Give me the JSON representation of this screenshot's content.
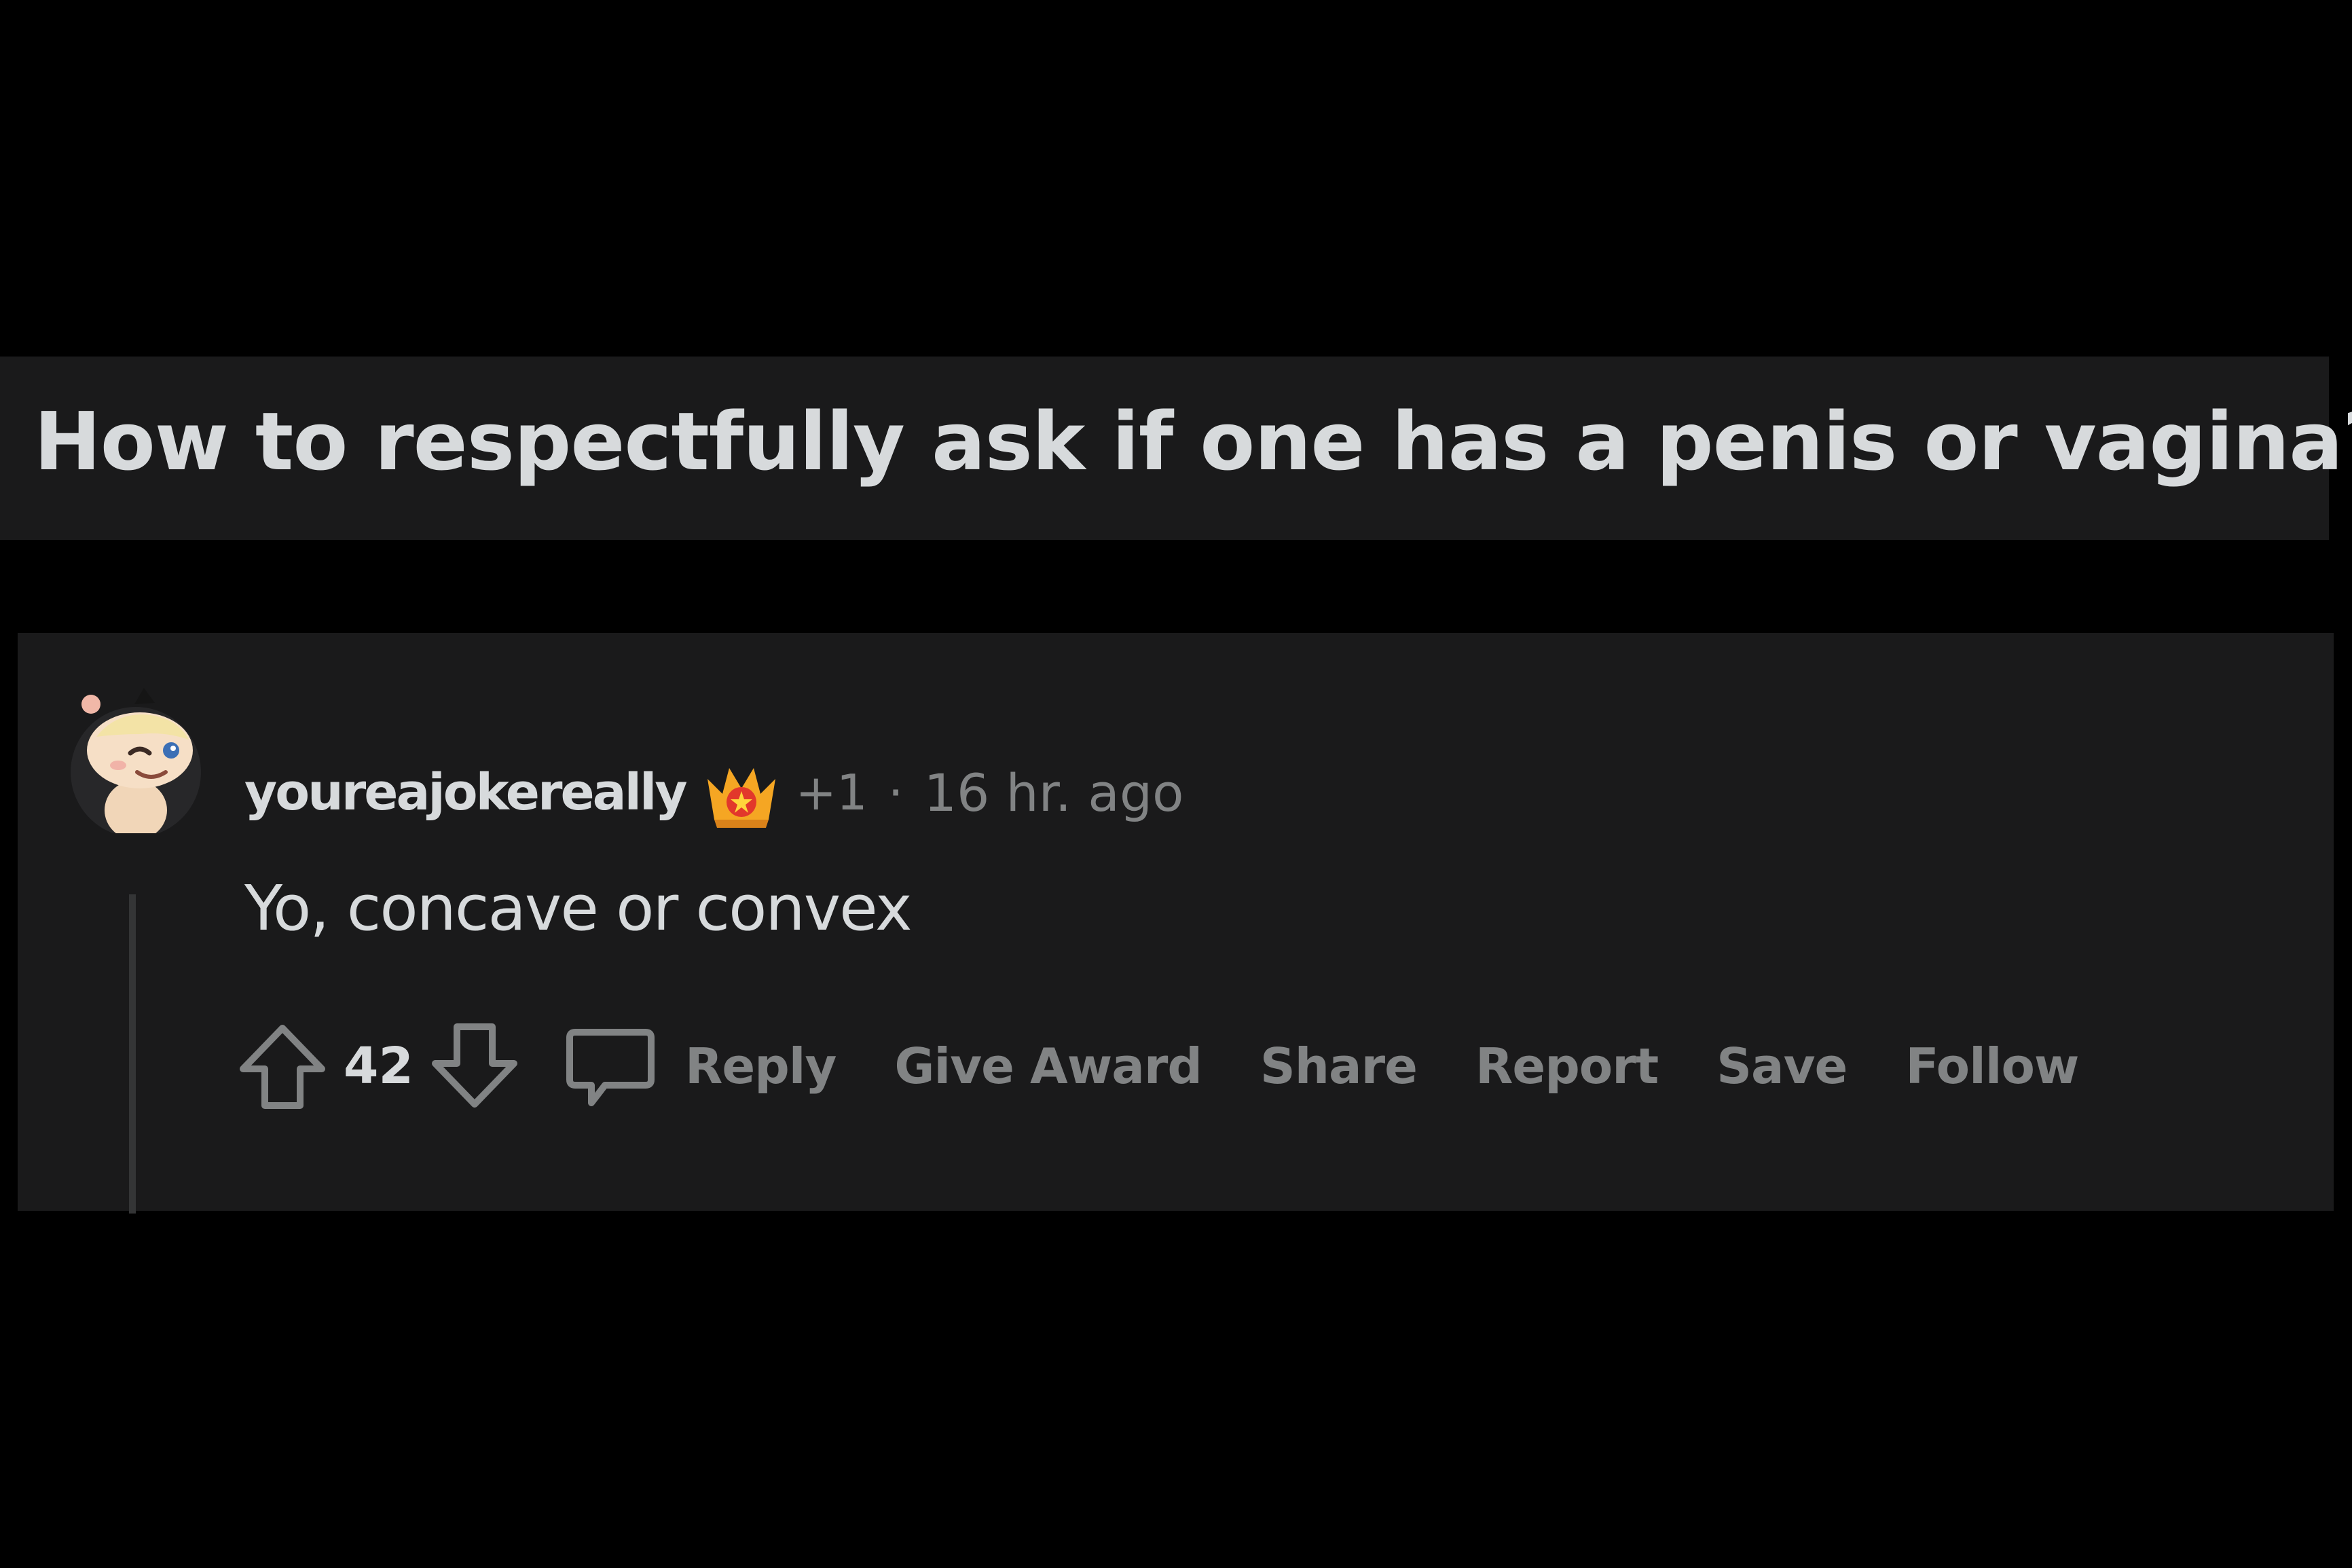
{
  "post": {
    "title": "How to respectfully ask if one has a penis or vagina?"
  },
  "comment": {
    "username": "youreajokereally",
    "award_count": "+1",
    "separator": "·",
    "timestamp": "16 hr. ago",
    "body": "Yo, concave or convex",
    "votes": "42",
    "actions": {
      "reply": "Reply",
      "give_award": "Give Award",
      "share": "Share",
      "report": "Report",
      "save": "Save",
      "follow": "Follow"
    }
  },
  "icons": {
    "avatar": "snoo-avatar-icon",
    "award": "crown-award-icon",
    "upvote": "upvote-arrow-icon",
    "downvote": "downvote-arrow-icon",
    "reply": "speech-bubble-icon"
  },
  "colors": {
    "page_background": "#000000",
    "card_background": "#1a1a1b",
    "primary_text": "#d7dadc",
    "secondary_text": "#818384",
    "thread_line": "#343536"
  }
}
